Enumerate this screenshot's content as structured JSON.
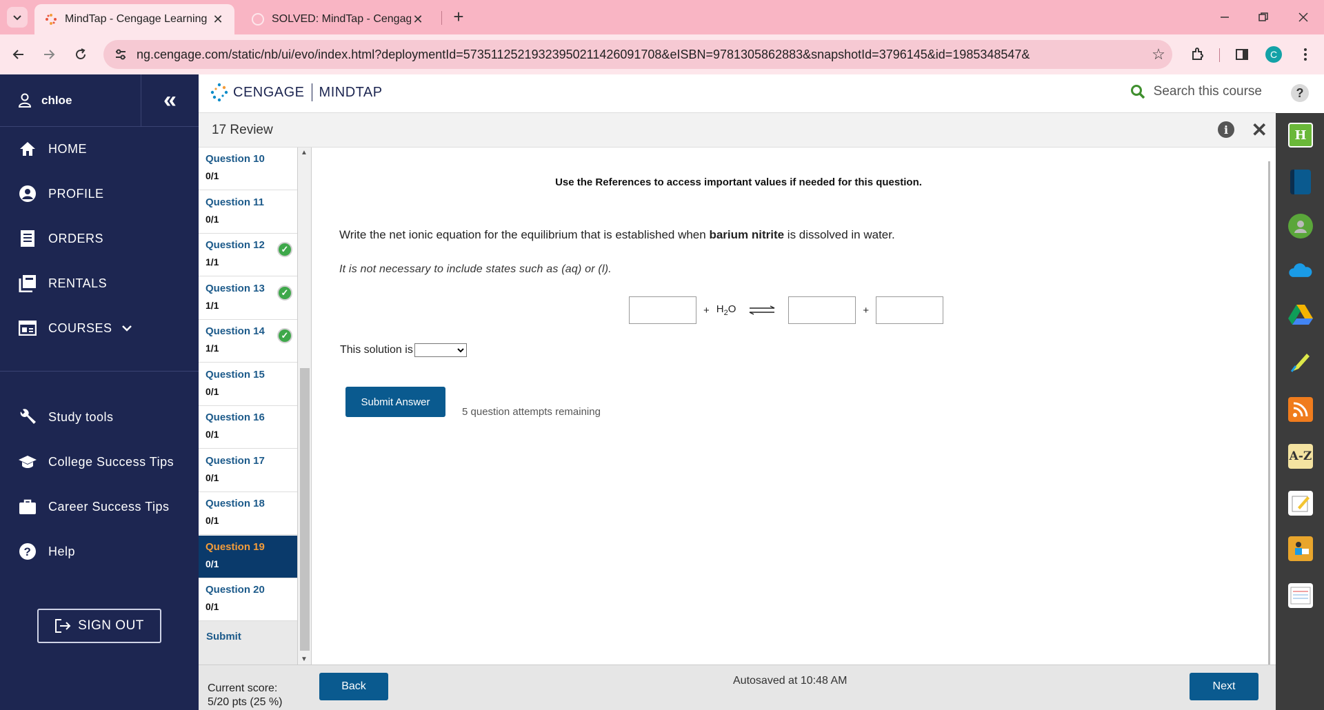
{
  "browser": {
    "tabs": [
      {
        "label": "MindTap - Cengage Learning",
        "active": true
      },
      {
        "label": "SOLVED: MindTap - Cengage Le",
        "active": false
      }
    ],
    "url": "ng.cengage.com/static/nb/ui/evo/index.html?deploymentId=57351125219323950211426091708&eISBN=9781305862883&snapshotId=3796145&id=1985348547&",
    "profile_initial": "C"
  },
  "sidebar": {
    "user_name": "chloe",
    "collapse_glyph": "«",
    "items": [
      {
        "label": "HOME",
        "icon": "home-icon"
      },
      {
        "label": "PROFILE",
        "icon": "user-icon"
      },
      {
        "label": "ORDERS",
        "icon": "receipt-icon"
      },
      {
        "label": "RENTALS",
        "icon": "books-icon"
      },
      {
        "label": "COURSES",
        "icon": "course-icon"
      },
      {
        "label": "Study tools",
        "icon": "wrench-icon"
      },
      {
        "label": "College Success Tips",
        "icon": "graduation-cap-icon"
      },
      {
        "label": "Career Success Tips",
        "icon": "briefcase-icon"
      },
      {
        "label": "Help",
        "icon": "help-icon"
      }
    ],
    "sign_out": "SIGN OUT"
  },
  "header": {
    "brand_left": "CENGAGE",
    "brand_right": "MINDTAP",
    "search_placeholder": "Search this course",
    "page_title": "17 Review"
  },
  "questions": [
    {
      "title": "Question 10",
      "score": "0/1",
      "correct": false,
      "current": false
    },
    {
      "title": "Question 11",
      "score": "0/1",
      "correct": false,
      "current": false
    },
    {
      "title": "Question 12",
      "score": "1/1",
      "correct": true,
      "current": false
    },
    {
      "title": "Question 13",
      "score": "1/1",
      "correct": true,
      "current": false
    },
    {
      "title": "Question 14",
      "score": "1/1",
      "correct": true,
      "current": false
    },
    {
      "title": "Question 15",
      "score": "0/1",
      "correct": false,
      "current": false
    },
    {
      "title": "Question 16",
      "score": "0/1",
      "correct": false,
      "current": false
    },
    {
      "title": "Question 17",
      "score": "0/1",
      "correct": false,
      "current": false
    },
    {
      "title": "Question 18",
      "score": "0/1",
      "correct": false,
      "current": false
    },
    {
      "title": "Question 19",
      "score": "0/1",
      "correct": false,
      "current": true
    },
    {
      "title": "Question 20",
      "score": "0/1",
      "correct": false,
      "current": false
    }
  ],
  "question_submit": "Submit",
  "content": {
    "references": "Use the References to access important values if needed for this question.",
    "prompt_before": "Write the net ionic equation for the equilibrium that is established when ",
    "prompt_bold": "barium nitrite",
    "prompt_after": " is dissolved in water.",
    "note": "It is not necessary to include states such as (aq) or (l).",
    "eq_plus": "+",
    "eq_water_main": "H",
    "eq_water_sub": "2",
    "eq_water_end": "O",
    "solution_label": "This solution is",
    "submit_button": "Submit Answer",
    "attempts": "5 question attempts remaining"
  },
  "footer": {
    "score_label": "Current score:",
    "score_value": "5/20 pts (25 %)",
    "back": "Back",
    "autosave": "Autosaved at 10:48 AM",
    "next": "Next"
  },
  "colors": {
    "sidebar": "#1d2651",
    "primary_button": "#0a5a8f",
    "current_question_bg": "#0a3a6b",
    "current_question_title": "#f39c3a",
    "chrome_tabbar": "#f9b5c4"
  }
}
